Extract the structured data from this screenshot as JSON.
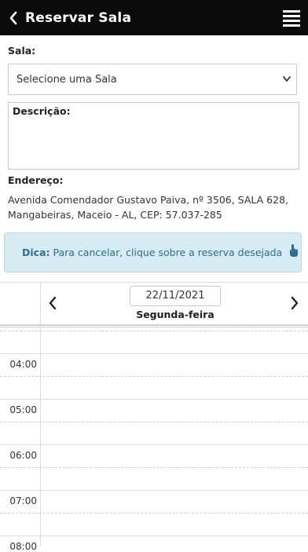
{
  "header": {
    "title": "Reservar Sala",
    "back_icon": "chevron-left-icon",
    "menu_icon": "hamburger-menu-icon"
  },
  "form": {
    "room_label": "Sala:",
    "room_select_value": "Selecione uma Sala",
    "description_label": "Descrição:",
    "address_label": "Endereço:",
    "address_line1": "Avenida Comendador Gustavo Paiva, nº 3506, SALA 628,",
    "address_line2": "Mangabeiras, Maceio - AL, CEP: 57.037-285"
  },
  "tip": {
    "label": "Dica:",
    "text": "Para cancelar, clique sobre a reserva desejada",
    "icon": "tap-hand-icon"
  },
  "calendar": {
    "date": "22/11/2021",
    "weekday": "Segunda-feira",
    "times": [
      "04:00",
      "05:00",
      "06:00",
      "07:00",
      "08:00"
    ]
  }
}
